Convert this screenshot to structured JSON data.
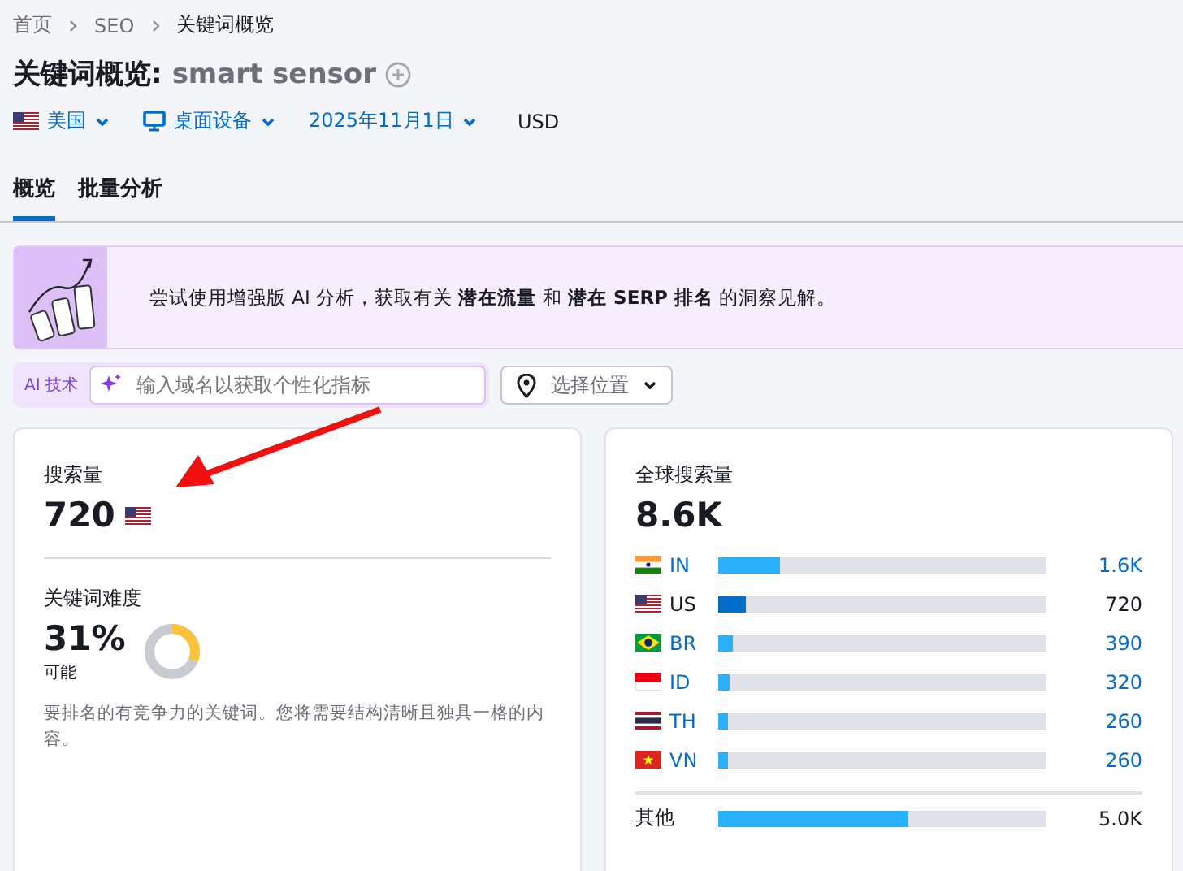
{
  "breadcrumb": [
    "首页",
    "SEO",
    "关键词概览"
  ],
  "title": {
    "prefix": "关键词概览:",
    "keyword": "smart sensor"
  },
  "filters": [
    {
      "kind": "country",
      "label": "美国"
    },
    {
      "kind": "device",
      "label": "桌面设备"
    },
    {
      "kind": "date",
      "label": "2025年11月1日"
    },
    {
      "kind": "currency",
      "label": "USD"
    }
  ],
  "tabs": [
    {
      "label": "概览",
      "selected": true
    },
    {
      "label": "批量分析",
      "selected": false
    }
  ],
  "banner": {
    "text": "尝试使用增强版 AI 分析，获取有关 **潜在流量** 和 **潜在 SERP 排名** 的洞察见解。"
  },
  "ai_bar": {
    "badge": "AI 技术",
    "placeholder": "输入域名以获取个性化指标",
    "location_button": "选择位置"
  },
  "volume_card": {
    "label": "搜索量",
    "value": "720",
    "difficulty_label": "关键词难度",
    "difficulty_value": "31%",
    "difficulty_meter": {
      "level": 0.31
    },
    "difficulty_rating": "可能",
    "description": "要排名的有竞争力的关键词。您将需要结构清晰且独具一格的内容。"
  },
  "global_card": {
    "label": "全球搜索量",
    "value": "8.6K",
    "rows": [
      {
        "kind": "in",
        "code": "IN",
        "level": 0.19,
        "reading": "1.6K",
        "selected": false
      },
      {
        "kind": "us",
        "code": "US",
        "level": 0.085,
        "reading": "720",
        "selected": true
      },
      {
        "kind": "br",
        "code": "BR",
        "level": 0.045,
        "reading": "390",
        "selected": false
      },
      {
        "kind": "id",
        "code": "ID",
        "level": 0.035,
        "reading": "320",
        "selected": false
      },
      {
        "kind": "th",
        "code": "TH",
        "level": 0.03,
        "reading": "260",
        "selected": false
      },
      {
        "kind": "vn",
        "code": "VN",
        "level": 0.03,
        "reading": "260",
        "selected": false
      }
    ],
    "other": {
      "label": "其他",
      "level": 0.58,
      "reading": "5.0K"
    }
  }
}
